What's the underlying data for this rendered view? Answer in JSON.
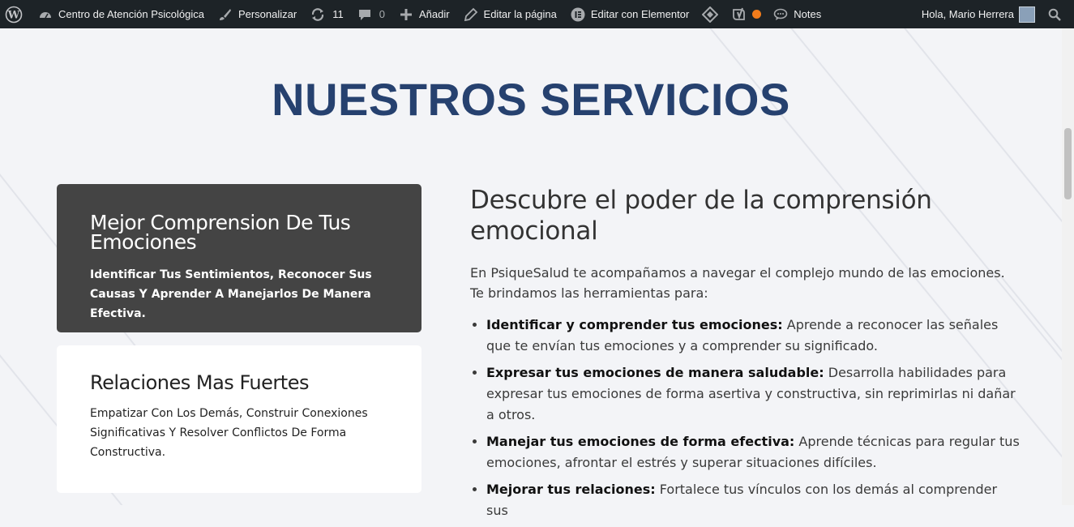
{
  "adminbar": {
    "site_name": "Centro de Atención Psicológica",
    "customize": "Personalizar",
    "updates_count": "11",
    "comments_count": "0",
    "add_new": "Añadir",
    "edit_page": "Editar la página",
    "edit_elementor": "Editar con Elementor",
    "notes": "Notes",
    "greeting": "Hola, Mario Herrera"
  },
  "page": {
    "title": "NUESTROS SERVICIOS"
  },
  "cards": [
    {
      "title": "Mejor Comprension De Tus Emociones",
      "text": "Identificar Tus Sentimientos, Reconocer Sus Causas Y Aprender A Manejarlos De Manera Efectiva."
    },
    {
      "title": "Relaciones Mas Fuertes",
      "text": "Empatizar Con Los Demás, Construir Conexiones Significativas Y Resolver Conflictos De Forma Constructiva."
    }
  ],
  "content": {
    "heading": "Descubre el poder de la comprensión emocional",
    "intro": "En PsiqueSalud te acompañamos a navegar el complejo mundo de las emociones. Te brindamos las herramientas para:",
    "items": [
      {
        "bold": "Identificar y comprender tus emociones:",
        "text": " Aprende a reconocer las señales que te envían tus emociones y a comprender su significado."
      },
      {
        "bold": "Expresar tus emociones de manera saludable:",
        "text": " Desarrolla habilidades para expresar tus emociones de forma asertiva y constructiva, sin reprimirlas ni dañar a otros."
      },
      {
        "bold": "Manejar tus emociones de forma efectiva:",
        "text": " Aprende técnicas para regular tus emociones, afrontar el estrés y superar situaciones difíciles."
      },
      {
        "bold": "Mejorar tus relaciones:",
        "text": " Fortalece tus vínculos con los demás al comprender sus"
      }
    ]
  },
  "colors": {
    "adminbar_bg": "#1d2327",
    "title": "#26416f",
    "card_dark": "#444444",
    "page_bg": "#f3f4f7",
    "notification_dot": "#f27c1b"
  }
}
